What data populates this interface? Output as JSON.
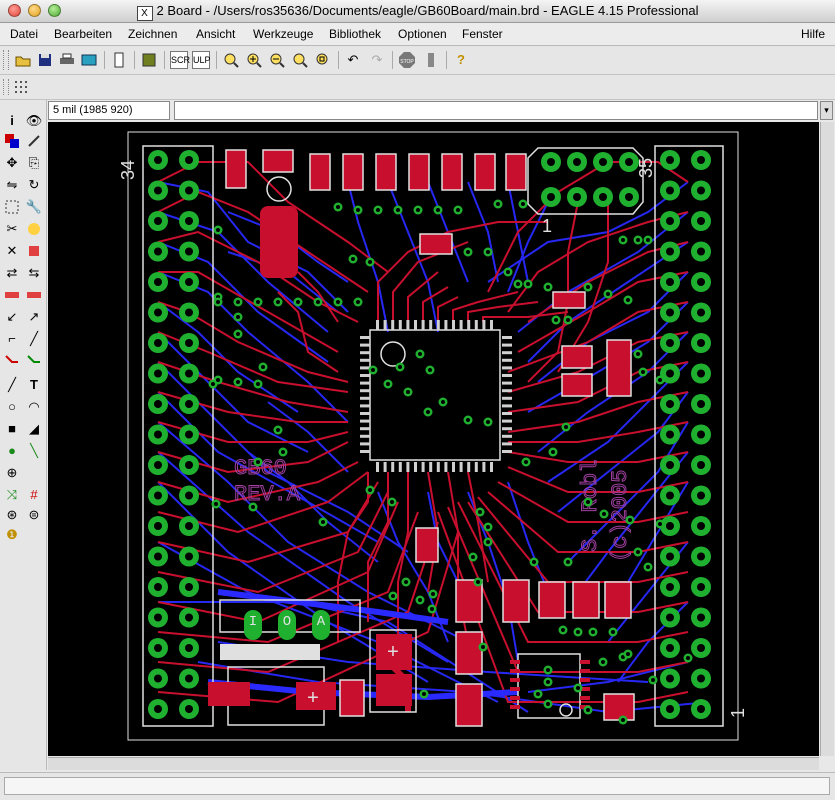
{
  "window": {
    "title": "2 Board - /Users/ros35636/Documents/eagle/GB60Board/main.brd - EAGLE 4.15 Professional",
    "app_icon_glyph": "X"
  },
  "menu": {
    "items": [
      "Datei",
      "Bearbeiten",
      "Zeichnen",
      "Ansicht",
      "Werkzeuge",
      "Bibliothek",
      "Optionen",
      "Fenster"
    ],
    "help": "Hilfe"
  },
  "toolbar": {
    "icons": [
      "open-icon",
      "save-icon",
      "print-icon",
      "cam-icon",
      "script-icon",
      "library-icon",
      "script-run-icon",
      "ulp-icon",
      "zoom-fit-icon",
      "zoom-in-icon",
      "zoom-out-icon",
      "redraw-icon",
      "zoom-select-icon",
      "undo-icon",
      "redo-icon",
      "stop-icon",
      "go-icon",
      "help-icon"
    ],
    "stop_label": "STOP",
    "help_glyph": "?"
  },
  "coordinates": {
    "value": "5 mil (1985 920)"
  },
  "command": {
    "value": ""
  },
  "board": {
    "silk_text_1": "GB60",
    "silk_text_2": "REV.A",
    "author_1": "S. Robl",
    "author_2": "(c)2005",
    "pin_label_top_left": "34",
    "pin_label_top_right": "35",
    "pin_label_header": "1",
    "pin_label_bottom_right": "1",
    "io_labels": [
      "I",
      "O",
      "A"
    ],
    "plus_sign": "+",
    "colors": {
      "background": "#000000",
      "top_copper": "#c8102e",
      "bottom_copper": "#2020ff",
      "pad": "#20b030",
      "via": "#28a060",
      "silk": "#e0e0e0",
      "text_layer": "#a040a0"
    }
  },
  "status": {
    "text": ""
  }
}
